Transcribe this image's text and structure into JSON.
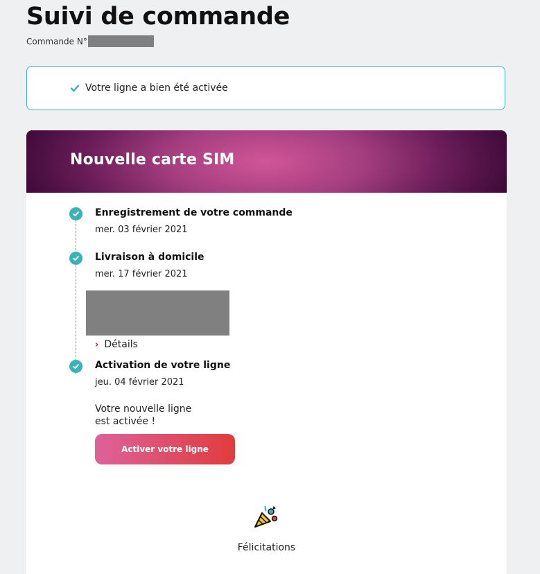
{
  "page": {
    "title": "Suivi de commande",
    "order_label": "Commande N°"
  },
  "alert": {
    "icon": "check-icon",
    "text": "Votre ligne a bien été activée",
    "border_color": "#3bb1b8"
  },
  "card": {
    "title": "Nouvelle carte SIM",
    "steps": [
      {
        "title": "Enregistrement de votre commande",
        "date": "mer. 03 février 2021",
        "status": "done"
      },
      {
        "title": "Livraison à domicile",
        "date": "mer. 17 février 2021",
        "status": "done",
        "details_label": "Détails"
      },
      {
        "title": "Activation de votre ligne",
        "date": "jeu. 04 février 2021",
        "status": "done",
        "note_line1": "Votre nouvelle ligne",
        "note_line2": "est activée !",
        "button_label": "Activer votre ligne"
      }
    ],
    "congrats_icon": "party-popper-icon",
    "congrats_text": "Félicitations"
  },
  "colors": {
    "accent_teal": "#3bb1b8",
    "header_purple": "#6b1d59",
    "button_pink": "#dd629a",
    "button_red": "#e03c3c"
  }
}
